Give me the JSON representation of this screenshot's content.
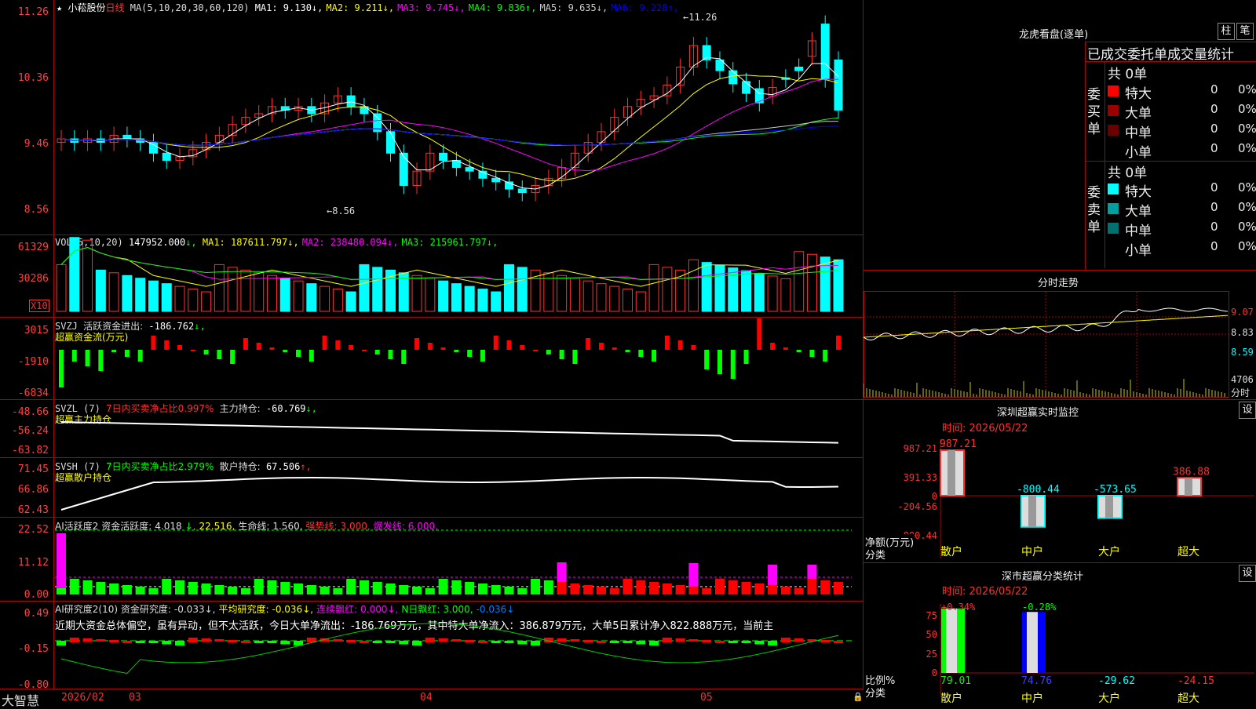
{
  "stock": {
    "star": "★",
    "name": "小菘股份",
    "period": "日线",
    "ma_label": "MA(5,10,20,30,60,120)",
    "ma": [
      {
        "label": "MA1:",
        "value": "9.130",
        "arrow": "↓",
        "color": "#ffffff"
      },
      {
        "label": "MA2:",
        "value": "9.211",
        "arrow": "↓",
        "color": "#ffff00"
      },
      {
        "label": "MA3:",
        "value": "9.745",
        "arrow": "↓",
        "color": "#ff00ff"
      },
      {
        "label": "MA4:",
        "value": "9.836",
        "arrow": "↑",
        "color": "#00ff00"
      },
      {
        "label": "MA5:",
        "value": "9.635",
        "arrow": "↓",
        "color": "#cccccc"
      },
      {
        "label": "MA6:",
        "value": "9.228",
        "arrow": "↑",
        "color": "#0000ff"
      }
    ],
    "high_mark": "11.26",
    "low_mark": "8.56",
    "price_axis": [
      "11.26",
      "10.36",
      "9.46",
      "8.56"
    ]
  },
  "volume": {
    "label": "VOL(5,10,20)",
    "value": "147952.000",
    "ma": [
      {
        "label": "MA1:",
        "value": "187611.797",
        "color": "#ffff00"
      },
      {
        "label": "MA2:",
        "value": "238480.094",
        "color": "#ff00ff"
      },
      {
        "label": "MA3:",
        "value": "215961.797",
        "color": "#00ff00"
      }
    ],
    "axis": [
      "61329",
      "30286"
    ],
    "unit": "X10"
  },
  "svzj": {
    "label": "SVZJ",
    "title": "活跃资金进出:",
    "value": "-186.762",
    "subtitle": "超赢资金流(万元)",
    "axis": [
      "3015",
      "-1910",
      "-6834"
    ]
  },
  "svzl": {
    "label": "SVZL (7)",
    "note": "7日内买卖净占比0.997%",
    "title": "主力持仓:",
    "value": "-60.769",
    "subtitle": "超赢主力持仓",
    "axis": [
      "-48.66",
      "-56.24",
      "-63.82"
    ]
  },
  "svsh": {
    "label": "SVSH (7)",
    "note": "7日内买卖净占比2.979%",
    "title": "散户持仓:",
    "value": "67.506",
    "subtitle": "超赢散户持仓",
    "axis": [
      "71.45",
      "66.86",
      "62.43"
    ]
  },
  "ai_active": {
    "label": "AI活跃度2",
    "items": [
      {
        "text": "资金活跃度:",
        "color": "#dddddd"
      },
      {
        "text": "4.018",
        "color": "#dddddd"
      },
      {
        "text": "↓,",
        "color": "#00ff00"
      },
      {
        "text": "22.516,",
        "color": "#ffff00"
      },
      {
        "text": "生命线:",
        "color": "#dddddd"
      },
      {
        "text": "1.560,",
        "color": "#dddddd"
      },
      {
        "text": "强势线:",
        "color": "#ff3030"
      },
      {
        "text": "3.000,",
        "color": "#ff3030"
      },
      {
        "text": "爆发线:",
        "color": "#ff00ff"
      },
      {
        "text": "6.000,",
        "color": "#ff00ff"
      }
    ],
    "axis": [
      "22.52",
      "11.12",
      "0.00"
    ]
  },
  "ai_research": {
    "label": "AI研究度2(10)",
    "items": [
      {
        "text": "资金研究度:",
        "color": "#dddddd"
      },
      {
        "text": "-0.033↓,",
        "color": "#dddddd"
      },
      {
        "text": "平均研究度:",
        "color": "#ffff00"
      },
      {
        "text": "-0.036↓,",
        "color": "#ffff00"
      },
      {
        "text": "连续飘红:",
        "color": "#ff00ff"
      },
      {
        "text": "0.000↓,",
        "color": "#ff00ff"
      },
      {
        "text": "N日飘红:",
        "color": "#00ff00"
      },
      {
        "text": "3.000,",
        "color": "#00ff00"
      },
      {
        "text": "-0.036↓",
        "color": "#0080ff"
      }
    ],
    "summary": "近期大资金总体偏空，虽有异动，但不太活跃，今日大单净流出：-186.769万元，其中特大单净流入：386.879万元，大单5日累计净入822.888万元，当前主",
    "axis": [
      "0.49",
      "-0.15",
      "-0.80"
    ]
  },
  "bottom_bar": {
    "brand": "大智慧",
    "dates": [
      "2026/02",
      "03",
      "04",
      "05"
    ]
  },
  "right": {
    "lhb_title": "龙虎看盘(逐单)",
    "btn_bar": "柱",
    "btn_stroke": "笔",
    "table_title": "已成交委托单成交量统计",
    "buy_side": "委买单",
    "sell_side": "委卖单",
    "buy_total": "共 0单",
    "sell_total": "共 0单",
    "buy_rows": [
      {
        "name": "特大",
        "count": "0",
        "pct": "0%",
        "color": "#ff0000"
      },
      {
        "name": "大单",
        "count": "0",
        "pct": "0%",
        "color": "#9a0000"
      },
      {
        "name": "中单",
        "count": "0",
        "pct": "0%",
        "color": "#6a0000"
      },
      {
        "name": "小单",
        "count": "0",
        "pct": "0%",
        "color": ""
      }
    ],
    "sell_rows": [
      {
        "name": "特大",
        "count": "0",
        "pct": "0%",
        "color": "#00ffff"
      },
      {
        "name": "大单",
        "count": "0",
        "pct": "0%",
        "color": "#00a0a0"
      },
      {
        "name": "中单",
        "count": "0",
        "pct": "0%",
        "color": "#007070"
      },
      {
        "name": "小单",
        "count": "0",
        "pct": "0%",
        "color": ""
      }
    ],
    "intraday_title": "分时走势",
    "intraday_axis": [
      "9.07",
      "8.83",
      "8.59"
    ],
    "intraday_vol": "4706",
    "intraday_vol_unit": "分时",
    "monitor_title": "深圳超赢实时监控",
    "monitor_btn": "设",
    "monitor_time": "时间: 2026/05/22",
    "monitor_axis": [
      "987.21",
      "391.33",
      "0",
      "-204.56",
      "-800.44"
    ],
    "monitor_ylabel": "净额(万元)",
    "monitor_xlabel": "分类",
    "monitor_bars": [
      {
        "cat": "散户",
        "value": "987.21"
      },
      {
        "cat": "中户",
        "value": "-800.44"
      },
      {
        "cat": "大户",
        "value": "-573.65"
      },
      {
        "cat": "超大",
        "value": "386.88"
      }
    ],
    "class_title": "深市超赢分类统计",
    "class_btn": "设",
    "class_time": "时间: 2026/05/22",
    "class_axis": [
      "75",
      "50",
      "25",
      "0"
    ],
    "class_ylabel": "比例%",
    "class_xlabel": "分类",
    "class_top": [
      "+0.34%",
      "-0.28%"
    ],
    "class_bars": [
      {
        "cat": "散户",
        "value": "79.01"
      },
      {
        "cat": "中户",
        "value": "74.76"
      },
      {
        "cat": "大户",
        "value": "-29.62"
      },
      {
        "cat": "超大",
        "value": "-24.15"
      }
    ]
  },
  "colors": {
    "up": "#ff3030",
    "down": "#00ffff",
    "grid": "#b00000"
  }
}
